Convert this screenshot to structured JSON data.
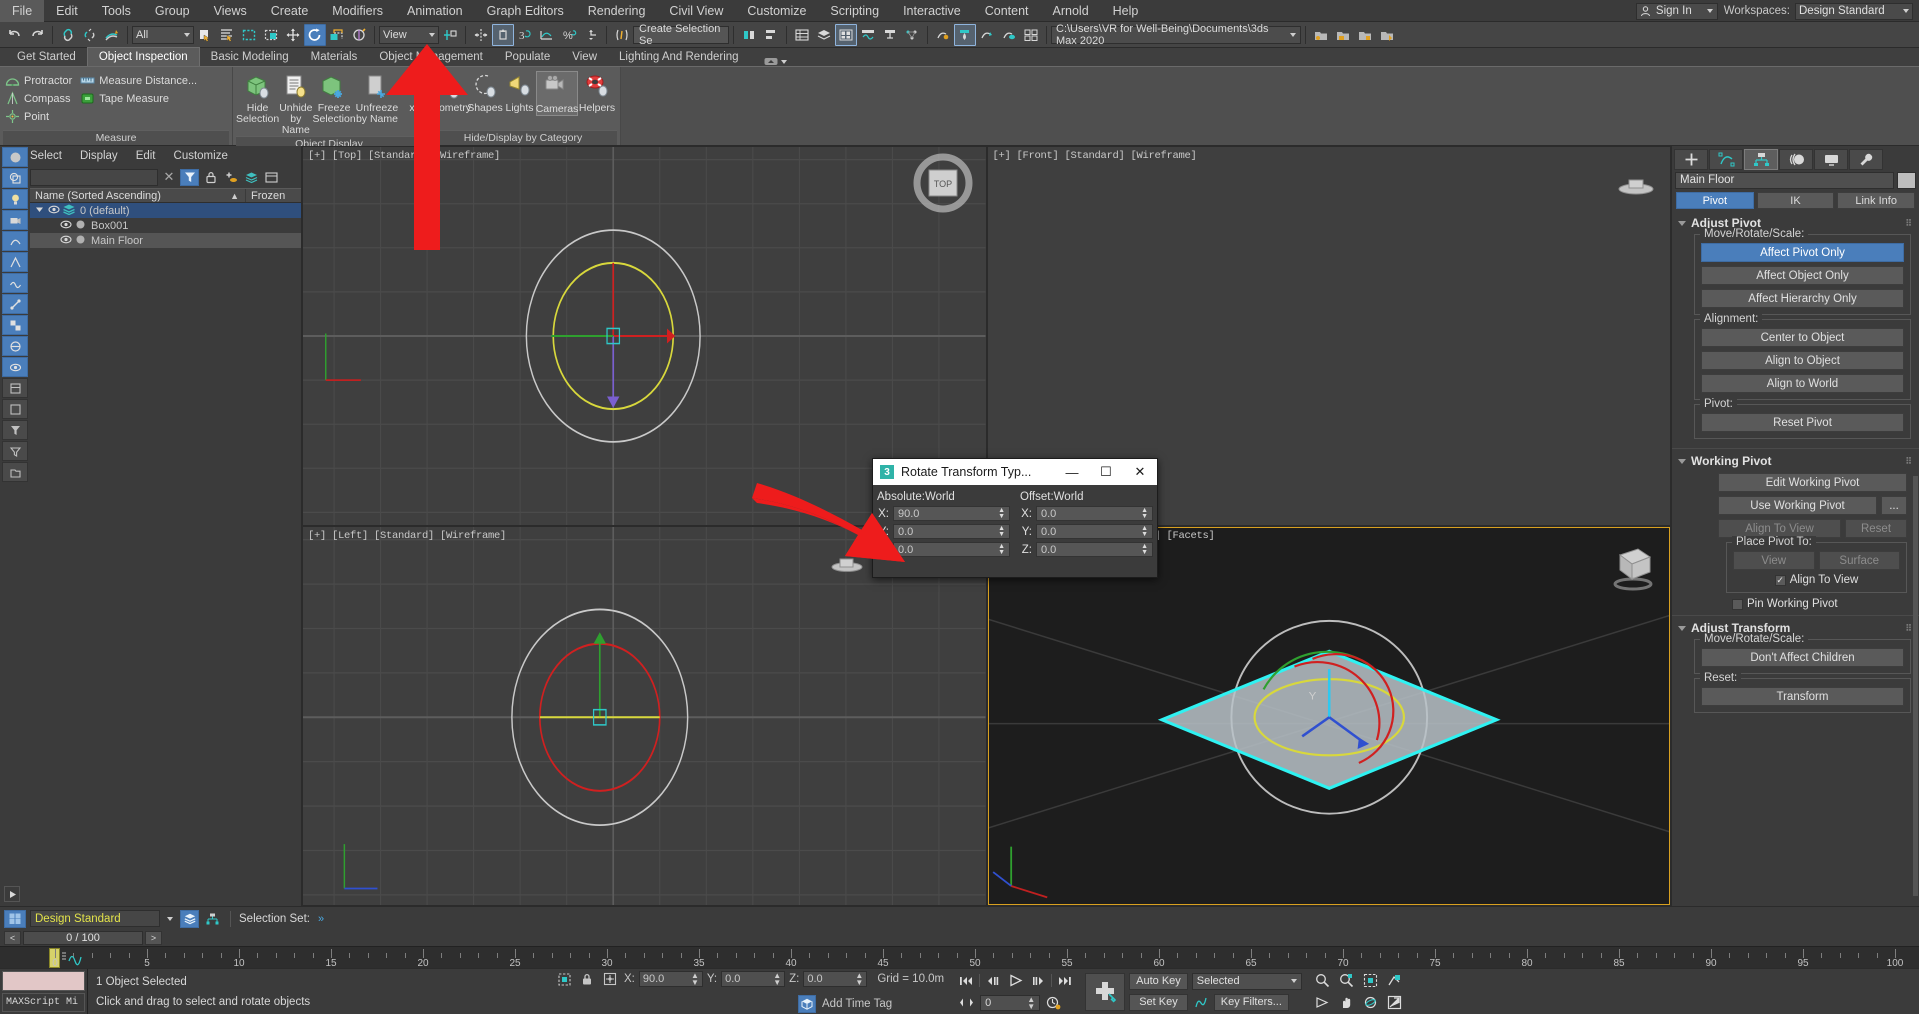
{
  "menubar": {
    "items": [
      "File",
      "Edit",
      "Tools",
      "Group",
      "Views",
      "Create",
      "Modifiers",
      "Animation",
      "Graph Editors",
      "Rendering",
      "Civil View",
      "Customize",
      "Scripting",
      "Interactive",
      "Content",
      "Arnold",
      "Help"
    ],
    "signin": "Sign In",
    "workspaces_label": "Workspaces:",
    "workspace_value": "Design Standard"
  },
  "toolbar": {
    "selection_filter": "All",
    "reference_coord": "View",
    "create_selection_set": "Create Selection Se",
    "project_path": "C:\\Users\\VR for Well-Being\\Documents\\3ds Max 2020"
  },
  "ribbon": {
    "tabs": [
      "Get Started",
      "Object Inspection",
      "Basic Modeling",
      "Materials",
      "Object Management",
      "Populate",
      "View",
      "Lighting And Rendering"
    ],
    "active_tab": "Object Inspection",
    "panels": [
      {
        "title": "Measure",
        "small_items": [
          "Protractor",
          "Measure Distance...",
          "Compass",
          "Tape Measure",
          "Point"
        ]
      },
      {
        "title": "Object Display",
        "big_items": [
          "Hide Selection",
          "Unhide by Name",
          "Freeze Selection",
          "Unfreeze by Name",
          "xView"
        ]
      },
      {
        "title": "Hide/Display by Category",
        "big_items": [
          "Geometry",
          "Shapes",
          "Lights",
          "Cameras",
          "Helpers"
        ],
        "selected": "Cameras"
      }
    ]
  },
  "explorer": {
    "menu": [
      "Select",
      "Display",
      "Edit",
      "Customize"
    ],
    "search_placeholder": "",
    "columns": [
      "Name (Sorted Ascending)",
      "Frozen"
    ],
    "sort_indicator": "▲",
    "rows": [
      {
        "name": "0 (default)",
        "indent": 0,
        "state": "selected"
      },
      {
        "name": "Box001",
        "indent": 1,
        "state": "normal"
      },
      {
        "name": "Main Floor",
        "indent": 1,
        "state": "highlight"
      }
    ]
  },
  "viewports": [
    {
      "label": "[+] [Top] [Standard] [Wireframe]",
      "type": "top",
      "active": false
    },
    {
      "label": "[+] [Front] [Standard] [Wireframe]",
      "type": "front",
      "active": false
    },
    {
      "label": "[+] [Left] [Standard] [Wireframe]",
      "type": "left",
      "active": false
    },
    {
      "label": "[+] [Perspective] [Standard] [Facets]",
      "type": "perspective",
      "active": true
    }
  ],
  "command_panel": {
    "tab_icons": [
      "create-icon",
      "modify-icon",
      "hierarchy-icon",
      "motion-icon",
      "display-icon",
      "utilities-icon"
    ],
    "active_tab_index": 2,
    "object_name": "Main Floor",
    "subtabs": [
      "Pivot",
      "IK",
      "Link Info"
    ],
    "active_subtab": "Pivot",
    "rollouts": [
      {
        "title": "Adjust Pivot",
        "groups": [
          {
            "label": "Move/Rotate/Scale:",
            "buttons": [
              {
                "text": "Affect Pivot Only",
                "state": "active"
              },
              {
                "text": "Affect Object Only",
                "state": "normal"
              },
              {
                "text": "Affect Hierarchy Only",
                "state": "normal"
              }
            ]
          },
          {
            "label": "Alignment:",
            "buttons": [
              {
                "text": "Center to Object",
                "state": "normal"
              },
              {
                "text": "Align to Object",
                "state": "normal"
              },
              {
                "text": "Align to World",
                "state": "normal"
              }
            ]
          },
          {
            "label": "Pivot:",
            "buttons": [
              {
                "text": "Reset Pivot",
                "state": "normal"
              }
            ]
          }
        ]
      },
      {
        "title": "Working Pivot",
        "plain_buttons": [
          {
            "text": "Edit Working Pivot",
            "state": "normal"
          }
        ],
        "row_buttons": [
          [
            {
              "text": "Use Working Pivot",
              "state": "normal"
            },
            {
              "text": "...",
              "state": "normal"
            }
          ],
          [
            {
              "text": "Align To View",
              "state": "disabled"
            },
            {
              "text": "Reset",
              "state": "disabled"
            }
          ]
        ],
        "groups": [
          {
            "label": "Place Pivot To:",
            "row": [
              {
                "text": "View",
                "state": "disabled"
              },
              {
                "text": "Surface",
                "state": "disabled"
              }
            ],
            "checkbox": {
              "text": "Align To View",
              "checked": true
            }
          }
        ],
        "checkbox_after": {
          "text": "Pin Working Pivot",
          "checked": false
        }
      },
      {
        "title": "Adjust Transform",
        "groups": [
          {
            "label": "Move/Rotate/Scale:",
            "buttons": [
              {
                "text": "Don't Affect Children",
                "state": "normal"
              }
            ]
          },
          {
            "label": "Reset:",
            "buttons": [
              {
                "text": "Transform",
                "state": "normal"
              }
            ]
          }
        ]
      }
    ]
  },
  "dialog": {
    "title": "Rotate Transform Typ...",
    "icon_text": "3",
    "buttons": {
      "minimize": "—",
      "maximize": "☐",
      "close": "✕"
    },
    "absolute": {
      "label": "Absolute:World",
      "fields": [
        {
          "axis": "X:",
          "value": "90.0"
        },
        {
          "axis": "Y:",
          "value": "0.0"
        },
        {
          "axis": "Z:",
          "value": "0.0"
        }
      ]
    },
    "offset": {
      "label": "Offset:World",
      "fields": [
        {
          "axis": "X:",
          "value": "0.0"
        },
        {
          "axis": "Y:",
          "value": "0.0"
        },
        {
          "axis": "Z:",
          "value": "0.0"
        }
      ]
    }
  },
  "statusbar": {
    "workspace_value": "Design Standard",
    "selection_set_label": "Selection Set:",
    "frame_counter": "0 / 100",
    "prev_arrow": "<",
    "next_arrow": ">",
    "maxscript_label": "MAXScript Mi",
    "selection_status": "1 Object Selected",
    "prompt": "Click and drag to select and rotate objects",
    "coords": [
      {
        "axis": "X:",
        "value": "90.0"
      },
      {
        "axis": "Y:",
        "value": "0.0"
      },
      {
        "axis": "Z:",
        "value": "0.0"
      }
    ],
    "grid": "Grid = 10.0m",
    "add_time_tag": "Add Time Tag",
    "key_frame_value": "0",
    "auto_key": "Auto Key",
    "set_key": "Set Key",
    "key_mode": "Selected",
    "key_filters": "Key Filters..."
  },
  "timeline": {
    "ticks": [
      0,
      5,
      10,
      15,
      20,
      25,
      30,
      35,
      40,
      45,
      50,
      55,
      60,
      65,
      70,
      75,
      80,
      85,
      90,
      95,
      100
    ],
    "current_frame": 0
  },
  "colors": {
    "accent_blue": "#4a7ebb",
    "panel_bg": "#3b3b3b",
    "ribbon_bg": "#5b5b5b",
    "arrow_red": "#ee1c1c",
    "selection_cyan": "#2ff2f2",
    "yellow_text": "#e3e34a"
  }
}
